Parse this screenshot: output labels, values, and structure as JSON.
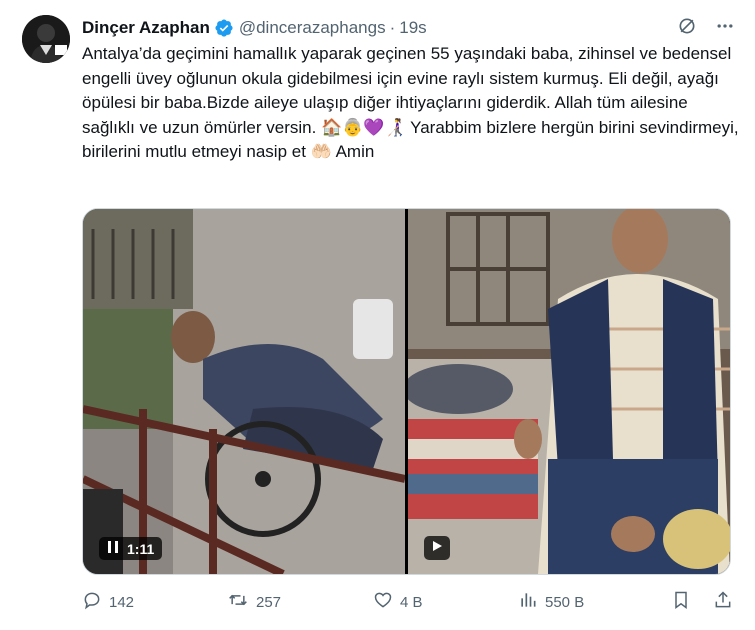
{
  "tweet": {
    "author_name": "Dinçer Azaphan",
    "handle": "@dincerazaphangs",
    "separator": "·",
    "time": "19s",
    "text": "Antalya’da geçimini hamallık yaparak geçinen 55 yaşındaki baba, zihinsel ve bedensel engelli üvey oğlunun okula gidebilmesi için evine raylı sistem kurmuş. Eli değil, ayağı öpülesi bir baba.Bizde aileye ulaşıp diğer ihtiyaçlarını giderdik. Allah tüm ailesine sağlıklı ve uzun ömürler versin. 🏠👵💜👩‍🦯 Yarabbim bizlere hergün birini sevindirmeyi, birilerini mutlu etmeyi nasip et 🤲🏻 Amin"
  },
  "media": {
    "video1_duration": "1:11"
  },
  "stats": {
    "replies": "142",
    "reposts": "257",
    "likes": "4 B",
    "views": "550 B"
  },
  "icons": {
    "verified": "verified-badge-icon",
    "grok": "grok-icon",
    "more": "more-icon",
    "reply": "reply-icon",
    "repost": "repost-icon",
    "like": "like-icon",
    "views": "views-icon",
    "bookmark": "bookmark-icon",
    "share": "share-icon"
  },
  "colors": {
    "text": "#0f1419",
    "secondary": "#536471",
    "verified": "#1d9bf0"
  }
}
